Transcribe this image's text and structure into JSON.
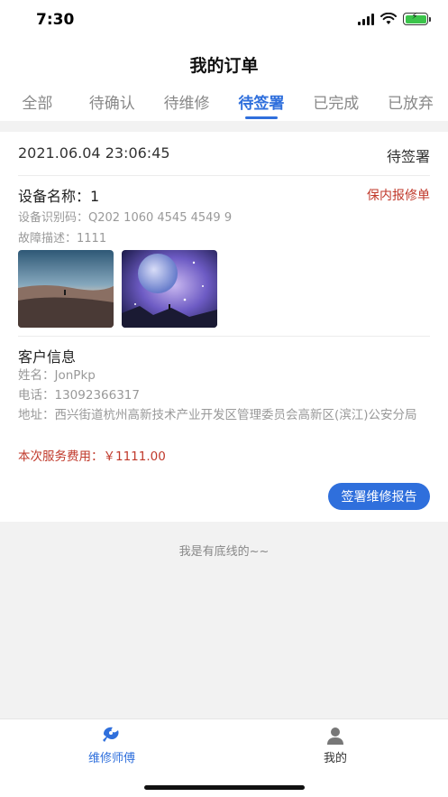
{
  "status_bar": {
    "time": "7:30"
  },
  "header": {
    "title": "我的订单"
  },
  "tabs": [
    {
      "label": "全部",
      "active": false
    },
    {
      "label": "待确认",
      "active": false
    },
    {
      "label": "待维修",
      "active": false
    },
    {
      "label": "待签署",
      "active": true
    },
    {
      "label": "已完成",
      "active": false
    },
    {
      "label": "已放弃",
      "active": false
    }
  ],
  "order": {
    "datetime": "2021.06.04 23:06:45",
    "status": "待签署",
    "device_name": "设备名称：1",
    "order_type": "保内报修单",
    "device_id": "设备识别码：Q202 1060 4545 4549 9",
    "fault_desc": "故障描述：1111",
    "customer_section_title": "客户信息",
    "customer_name": "姓名：JonPkp",
    "customer_phone": "电话：13092366317",
    "customer_address": "地址：西兴街道杭州高新技术产业开发区管理委员会高新区(滨江)公安分局",
    "service_fee": "本次服务费用：￥1111.00",
    "sign_button": "签署维修报告"
  },
  "list_end_text": "我是有底线的~~",
  "tabbar": [
    {
      "label": "维修师傅",
      "icon": "wrench-logo-icon",
      "active": true
    },
    {
      "label": "我的",
      "icon": "user-icon",
      "active": false
    }
  ],
  "colors": {
    "accent": "#2f6fdc",
    "price": "#c0392b",
    "muted": "#999999"
  }
}
